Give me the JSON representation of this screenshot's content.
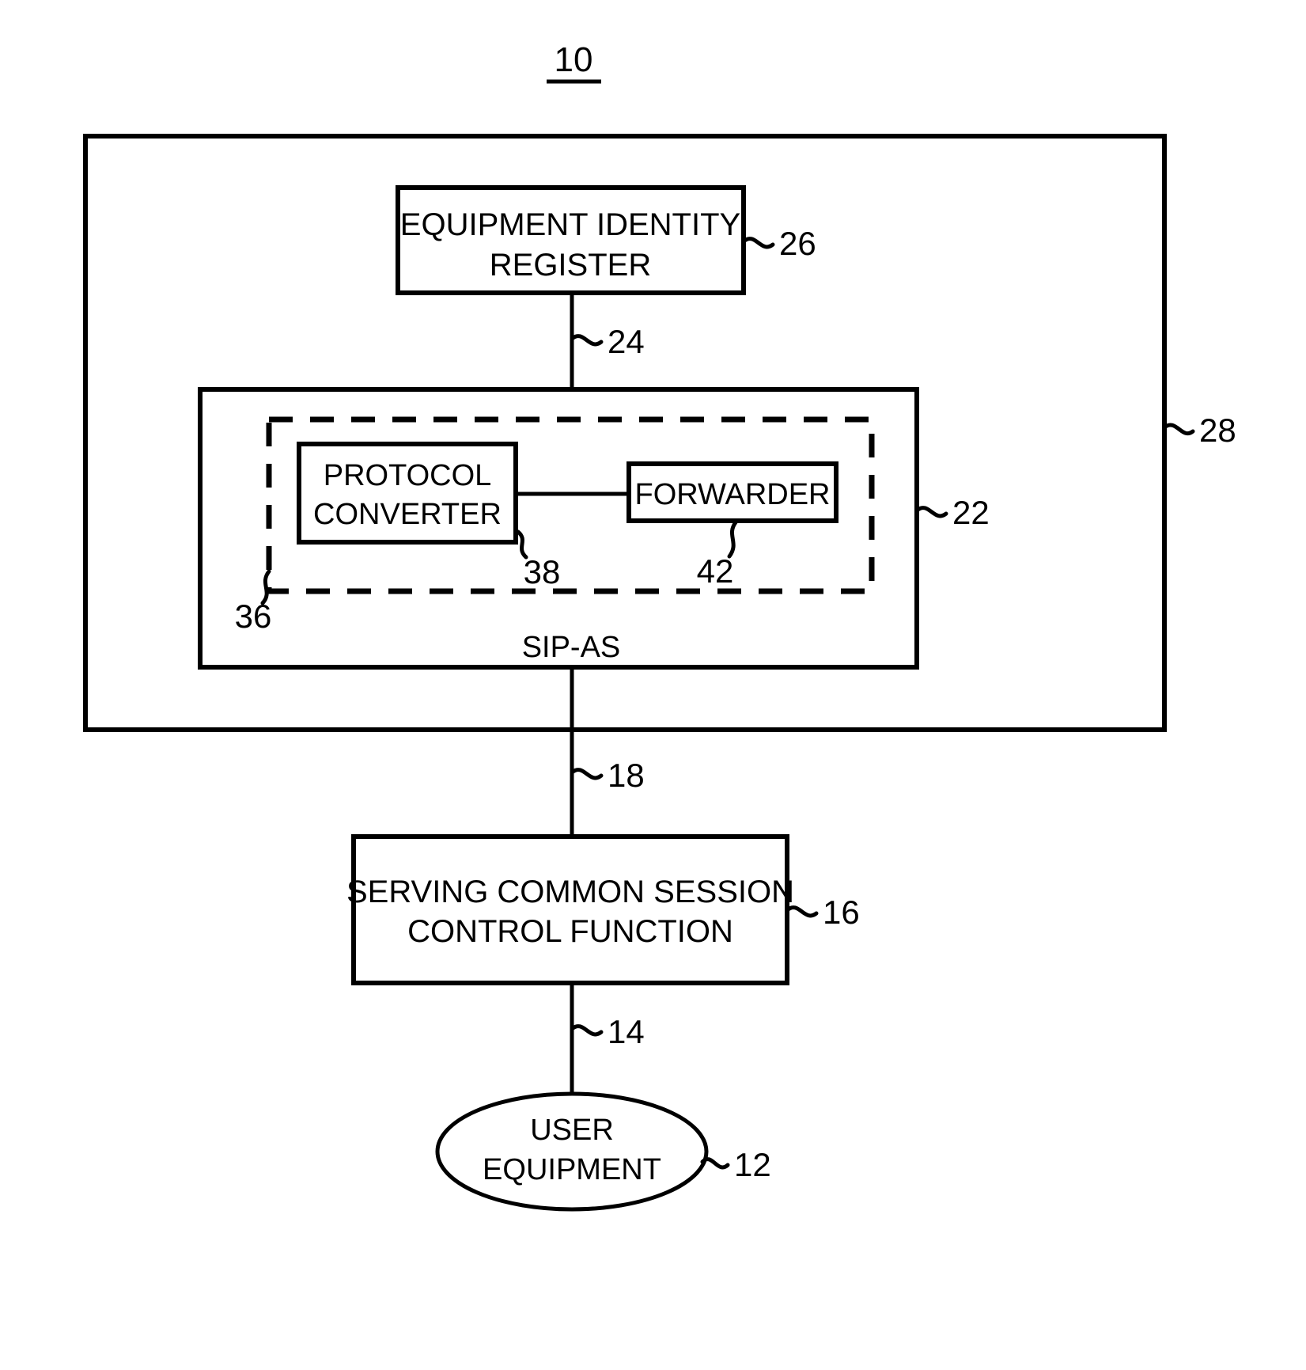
{
  "figure": {
    "title": "10",
    "system_label": "28",
    "system_boundary_name": "system-boundary"
  },
  "nodes": {
    "eir": {
      "line1": "EQUIPMENT IDENTITY",
      "line2": "REGISTER",
      "ref": "26"
    },
    "sip_as": {
      "label": "SIP-AS",
      "ref": "22"
    },
    "inner_module": {
      "ref": "36"
    },
    "protocol_converter": {
      "line1": "PROTOCOL",
      "line2": "CONVERTER",
      "ref": "38"
    },
    "forwarder": {
      "label": "FORWARDER",
      "ref": "42"
    },
    "scscf": {
      "line1": "SERVING COMMON SESSION",
      "line2": "CONTROL FUNCTION",
      "ref": "16"
    },
    "user_equipment": {
      "line1": "USER",
      "line2": "EQUIPMENT",
      "ref": "12"
    }
  },
  "connections": {
    "eir_to_sipas": {
      "ref": "24"
    },
    "sipas_to_scscf": {
      "ref": "18"
    },
    "scscf_to_ue": {
      "ref": "14"
    },
    "pc_to_forwarder": {
      "ref": ""
    }
  },
  "colors": {
    "ink": "#000000",
    "background": "#ffffff"
  }
}
